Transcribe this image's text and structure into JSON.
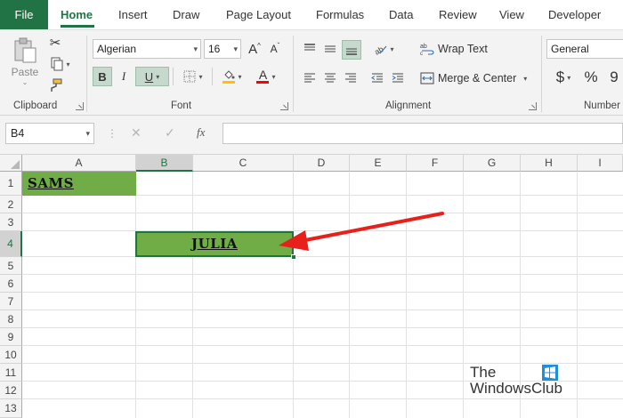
{
  "tabs": {
    "file": "File",
    "home": "Home",
    "insert": "Insert",
    "draw": "Draw",
    "page_layout": "Page Layout",
    "formulas": "Formulas",
    "data": "Data",
    "review": "Review",
    "view": "View",
    "developer": "Developer"
  },
  "ribbon": {
    "clipboard": {
      "paste_label": "Paste",
      "group_label": "Clipboard"
    },
    "font": {
      "font_name": "Algerian",
      "font_size": "16",
      "grow_label": "A",
      "shrink_label": "A",
      "bold_label": "B",
      "italic_label": "I",
      "underline_label": "U",
      "font_color_label": "A",
      "group_label": "Font",
      "fill_color": "#ffc000",
      "font_color": "#ff0000"
    },
    "alignment": {
      "wrap_text_label": "Wrap Text",
      "merge_center_label": "Merge & Center",
      "group_label": "Alignment"
    },
    "number": {
      "format": "General",
      "currency_label": "$",
      "percent_label": "%",
      "comma_label": "9",
      "group_label": "Number"
    }
  },
  "formula_bar": {
    "name_box": "B4",
    "fx_label": "fx",
    "cancel_label": "✕",
    "enter_label": "✓",
    "formula": ""
  },
  "grid": {
    "columns": [
      "A",
      "B",
      "C",
      "D",
      "E",
      "F",
      "G",
      "H",
      "I"
    ],
    "rows": [
      "1",
      "2",
      "3",
      "4",
      "5",
      "6",
      "7",
      "8",
      "9",
      "10",
      "11",
      "12",
      "13"
    ],
    "selected_column": "B",
    "selected_row": "4",
    "cells": {
      "A1": "SAMS",
      "B4": "JULIA"
    },
    "fill_color": "#70ad47",
    "accent_color": "#217346"
  },
  "annotation": {
    "arrow_color": "#e8201b"
  },
  "watermark": {
    "line1": "The",
    "line2": "WindowsClub"
  }
}
